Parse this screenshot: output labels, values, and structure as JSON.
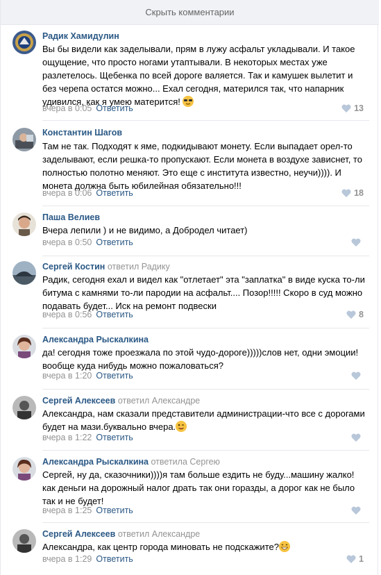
{
  "hide_label": "Скрыть комментарии",
  "reply_label": "Ответить",
  "comments": [
    {
      "author": "Радик Хамидулин",
      "replied": "",
      "target": "",
      "text": "Вы бы видели как заделывали, прям в лужу асфальт укладывали. И такое ощущение, что просто ногами утаптывали. В некоторых местах уже разлетелось. Щебенка по всей дороге валяется. Так и камушек вылетит и без черепа остатся можно... Ехал сегодня, матерился так, что напарник удивился, как я умею матерится!",
      "emoji": "sunglasses",
      "time": "вчера в 0:05",
      "likes": "13"
    },
    {
      "author": "Константин Шагов",
      "replied": "",
      "target": "",
      "text": "Там не так. Подходят к яме, подкидывают монету. Если выпадает орел-то заделывают, если решка-то пропускают. Если монета в воздухе зависнет, то полностью полотно меняют. Это еще с института известно, неучи)))). И монета должна быть юбилейная обязательно!!!",
      "emoji": "",
      "time": "вчера в 0:06",
      "likes": "18"
    },
    {
      "author": "Паша Велиев",
      "replied": "",
      "target": "",
      "text": "Вчера лепили ) и не видимо, а Добродел читает)",
      "emoji": "",
      "time": "вчера в 0:50",
      "likes": ""
    },
    {
      "author": "Сергей Костин",
      "replied": "ответил",
      "target": "Радику",
      "text": "Радик, сегодня ехал и видел как \"отлетает\" эта \"заплатка\" в виде куска то-ли битума с камнями то-ли пародии на асфальт.... Позор!!!!! Скоро в суд можно подавать будет... Иск на ремонт подвески",
      "emoji": "",
      "time": "вчера в 0:56",
      "likes": "8"
    },
    {
      "author": "Александра Рыскалкина",
      "replied": "",
      "target": "",
      "text": "да! сегодня тоже проезжала по этой чудо-дороге)))))слов нет, одни эмоции! вообще куда нибудь можно пожаловаться?",
      "emoji": "",
      "time": "вчера в 1:20",
      "likes": ""
    },
    {
      "author": "Сергей Алексеев",
      "replied": "ответил",
      "target": "Александре",
      "text": "Александра, нам сказали представители администрации-что все с дорогами будет на мази.буквально вчера.",
      "emoji": "wink",
      "time": "вчера в 1:22",
      "likes": ""
    },
    {
      "author": "Александра Рыскалкина",
      "replied": "ответила",
      "target": "Сергею",
      "text": "Сергей, ну да, сказочники))))я там больше ездить не буду...машину жалко! как деньги на дорожный налог драть так они горазды, а дорог как не было так и не будет!",
      "emoji": "",
      "time": "вчера в 1:25",
      "likes": ""
    },
    {
      "author": "Сергей Алексеев",
      "replied": "ответил",
      "target": "Александре",
      "text": "Александра, как центр города миновать не подскажите?",
      "emoji": "grin",
      "time": "вчера в 1:29",
      "likes": "1"
    }
  ]
}
